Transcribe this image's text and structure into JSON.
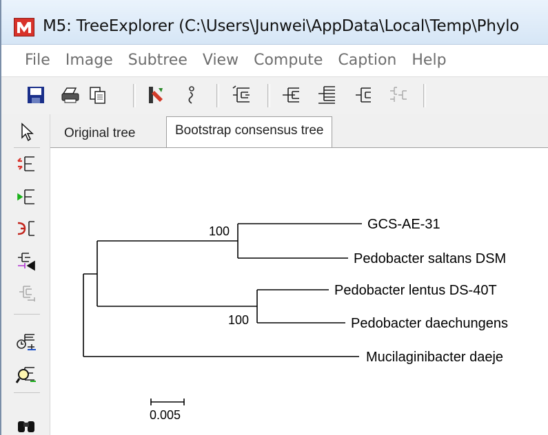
{
  "window": {
    "title": "M5: TreeExplorer (C:\\Users\\Junwei\\AppData\\Local\\Temp\\Phylo"
  },
  "menu": [
    "File",
    "Image",
    "Subtree",
    "View",
    "Compute",
    "Caption",
    "Help"
  ],
  "tabs": [
    {
      "label": "Original tree",
      "active": false
    },
    {
      "label": "Bootstrap consensus tree",
      "active": true
    }
  ],
  "tree": {
    "taxa": [
      "GCS-AE-31",
      "Pedobacter saltans DSM",
      "Pedobacter lentus DS-40T",
      "Pedobacter daechungens",
      "Mucilaginibacter daeje"
    ],
    "bootstrap": [
      "100",
      "100"
    ],
    "scale_label": "0.005"
  },
  "colors": {
    "accent_red": "#d8322a",
    "line": "#000000",
    "menu_text": "#6d6d6d"
  }
}
